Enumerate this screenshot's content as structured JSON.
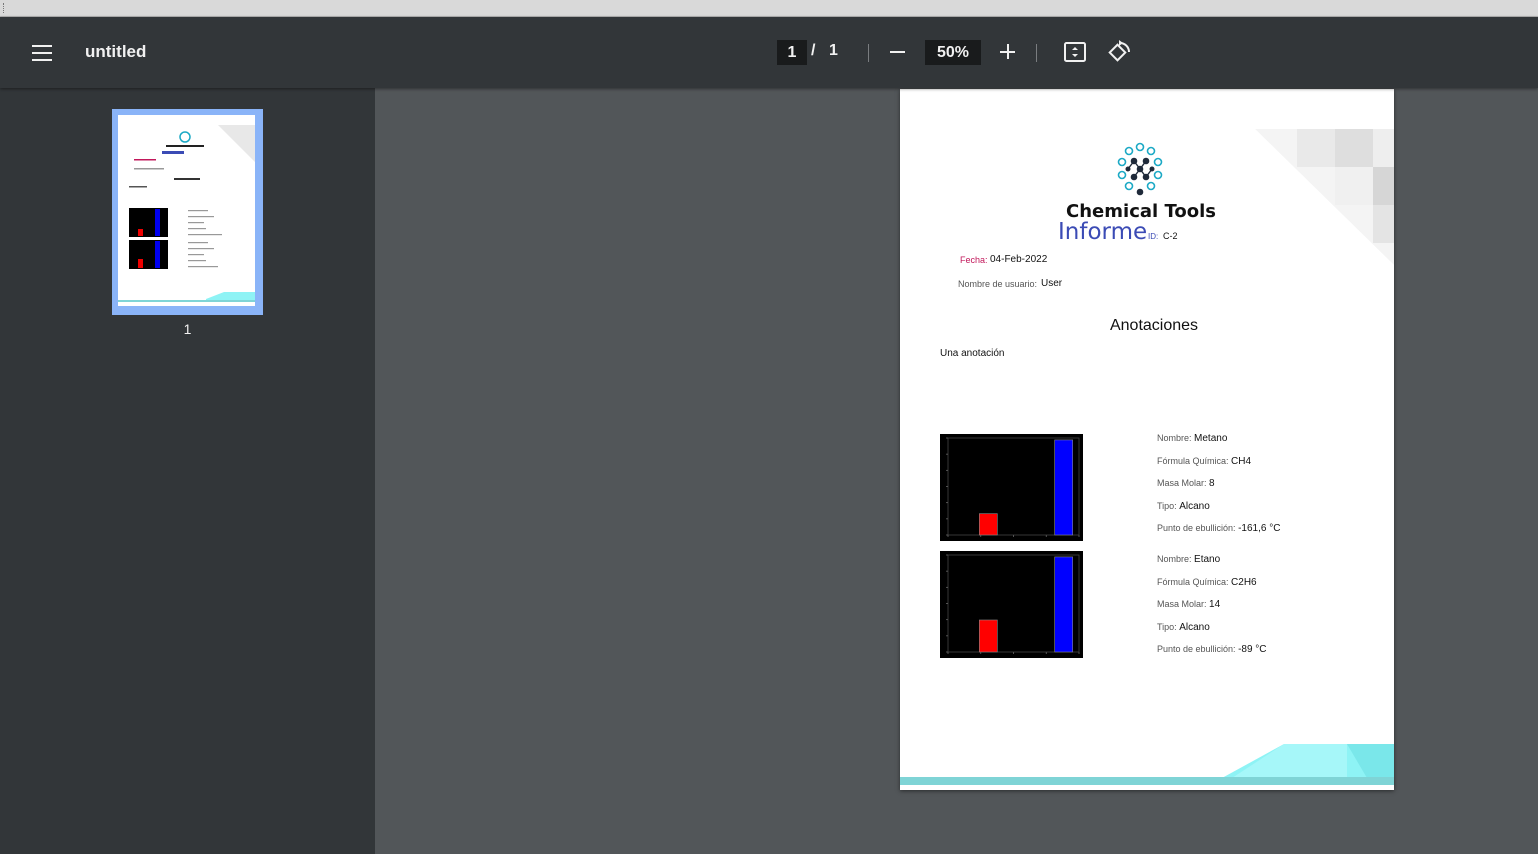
{
  "toolbar": {
    "title": "untitled",
    "page_current": "1",
    "page_separator": "/",
    "page_total": "1",
    "zoom": "50%"
  },
  "sidebar": {
    "thumbnails": [
      {
        "label": "1"
      }
    ]
  },
  "document": {
    "brand": "Chemical Tools",
    "heading": "Informe",
    "id_label": "ID:",
    "id_value": "C-2",
    "date_label": "Fecha:",
    "date_value": "04-Feb-2022",
    "user_label": "Nombre de usuario:",
    "user_value": "User",
    "section_title": "Anotaciones",
    "annotation": "Una anotación",
    "compounds": [
      {
        "name_label": "Nombre:",
        "name": "Metano",
        "formula_label": "Fórmula Química:",
        "formula": "CH4",
        "mass_label": "Masa Molar:",
        "mass": "8",
        "type_label": "Tipo:",
        "type": "Alcano",
        "boiling_label": "Punto de ebullición:",
        "boiling": "-161,6 °C"
      },
      {
        "name_label": "Nombre:",
        "name": "Etano",
        "formula_label": "Fórmula Química:",
        "formula": "C2H6",
        "mass_label": "Masa Molar:",
        "mass": "14",
        "type_label": "Tipo:",
        "type": "Alcano",
        "boiling_label": "Punto de ebullición:",
        "boiling": "-89 °C"
      }
    ]
  },
  "chart_data": [
    {
      "type": "bar",
      "categories": [
        "",
        ""
      ],
      "values": [
        0.22,
        0.98
      ],
      "colors": [
        "#ff0000",
        "#0000ff"
      ],
      "title": "",
      "xlabel": "",
      "ylabel": "",
      "ylim": [
        0,
        1
      ],
      "background": "#000000"
    },
    {
      "type": "bar",
      "categories": [
        "",
        ""
      ],
      "values": [
        0.33,
        0.98
      ],
      "colors": [
        "#ff0000",
        "#0000ff"
      ],
      "title": "",
      "xlabel": "",
      "ylabel": "",
      "ylim": [
        0,
        1
      ],
      "background": "#000000"
    }
  ]
}
